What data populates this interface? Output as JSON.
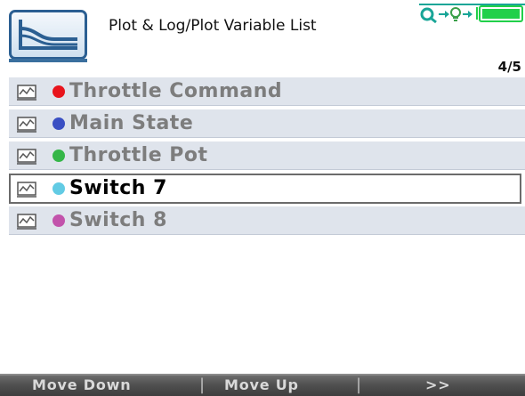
{
  "header": {
    "title": "Plot & Log/Plot Variable List",
    "page_counter": "4/5",
    "app_icon": "chart-waves-icon",
    "status_icons": [
      "connection-link-icon",
      "bulb-icon",
      "battery-icon"
    ]
  },
  "list": {
    "items": [
      {
        "label": "Throttle Command",
        "dot_color": "#e8141c",
        "icon": "plot-icon",
        "selected": false
      },
      {
        "label": "Main State",
        "dot_color": "#3a4fc3",
        "icon": "plot-icon",
        "selected": false
      },
      {
        "label": "Throttle Pot",
        "dot_color": "#35b648",
        "icon": "plot-icon",
        "selected": false
      },
      {
        "label": "Switch 7",
        "dot_color": "#62cbe4",
        "icon": "plot-icon",
        "selected": true
      },
      {
        "label": "Switch 8",
        "dot_color": "#c253ab",
        "icon": "plot-icon",
        "selected": false
      }
    ]
  },
  "footer": {
    "buttons": [
      {
        "label": "Move Down"
      },
      {
        "label": "Move Up"
      },
      {
        "label": ">>"
      }
    ],
    "separator": "|"
  },
  "colors": {
    "row_bg": "#dfe4ec",
    "accent_blue": "#2b5f92",
    "status_teal": "#19a597",
    "status_green": "#21d04a"
  }
}
